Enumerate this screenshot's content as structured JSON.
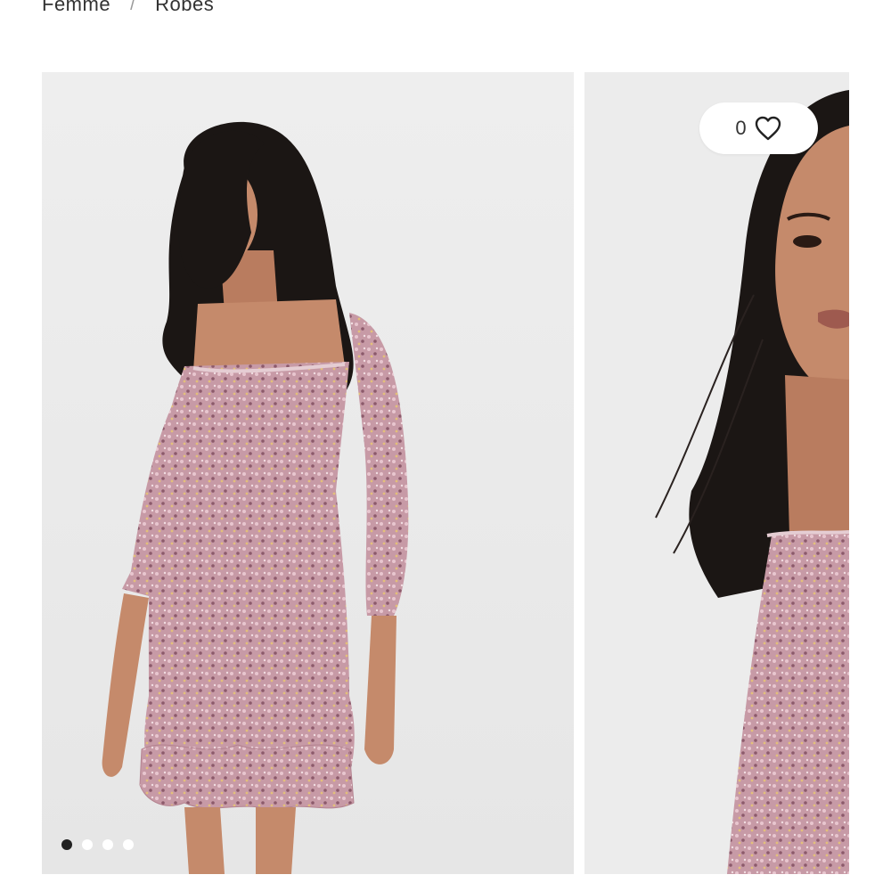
{
  "breadcrumb": {
    "items": [
      "Femme",
      "Robes"
    ],
    "separator": "/"
  },
  "gallery": {
    "images": [
      {
        "label": "product-photo-full-length"
      },
      {
        "label": "product-photo-closeup"
      }
    ],
    "active_index": 0,
    "dot_count": 4
  },
  "wishlist": {
    "count": "0",
    "icon": "heart-outline-icon"
  },
  "colors": {
    "background": "#ffffff",
    "photo_background": "#ebebeb",
    "dress": "#c79aa6",
    "hair": "#1b1614",
    "skin": "#c58a6b",
    "active_dot": "#222222"
  }
}
